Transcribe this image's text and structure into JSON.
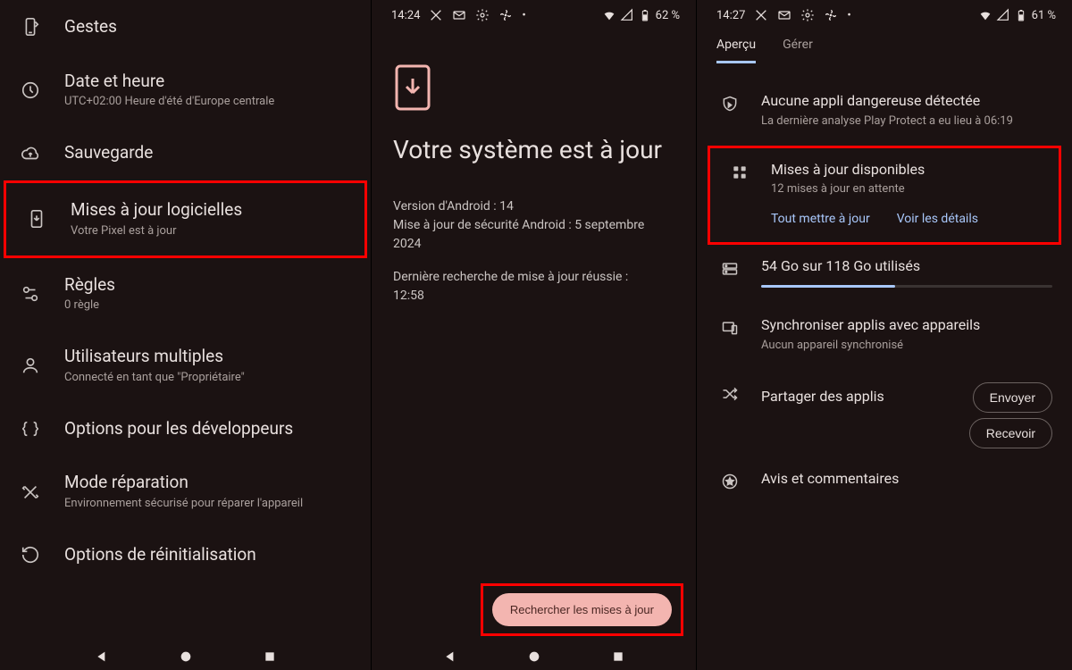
{
  "screen1": {
    "rows": [
      {
        "title": "Gestes",
        "sub": ""
      },
      {
        "title": "Date et heure",
        "sub": "UTC+02:00 Heure d'été d'Europe centrale"
      },
      {
        "title": "Sauvegarde",
        "sub": ""
      },
      {
        "title": "Mises à jour logicielles",
        "sub": "Votre Pixel est à jour"
      },
      {
        "title": "Règles",
        "sub": "0 règle"
      },
      {
        "title": "Utilisateurs multiples",
        "sub": "Connecté en tant que \"Propriétaire\""
      },
      {
        "title": "Options pour les développeurs",
        "sub": ""
      },
      {
        "title": "Mode réparation",
        "sub": "Environnement sécurisé pour réparer l'appareil"
      },
      {
        "title": "Options de réinitialisation",
        "sub": ""
      }
    ]
  },
  "screen2": {
    "status": {
      "time": "14:24",
      "battery": "62 %"
    },
    "heading": "Votre système est à jour",
    "line1": "Version d'Android : 14",
    "line2": "Mise à jour de sécurité Android : 5 septembre 2024",
    "line3a": "Dernière recherche de mise à jour réussie :",
    "line3b": "12:58",
    "button": "Rechercher les mises à jour"
  },
  "screen3": {
    "status": {
      "time": "14:27",
      "battery": "61 %"
    },
    "tabs": {
      "overview": "Aperçu",
      "manage": "Gérer"
    },
    "protect": {
      "title": "Aucune appli dangereuse détectée",
      "sub": "La dernière analyse Play Protect a eu lieu à 06:19"
    },
    "updates": {
      "title": "Mises à jour disponibles",
      "sub": "12 mises à jour en attente",
      "action1": "Tout mettre à jour",
      "action2": "Voir les détails"
    },
    "storage": {
      "title": "54 Go sur 118 Go utilisés"
    },
    "sync": {
      "title": "Synchroniser applis avec appareils",
      "sub": "Aucun appareil synchronisé"
    },
    "share": {
      "title": "Partager des applis",
      "send": "Envoyer",
      "receive": "Recevoir"
    },
    "reviews": {
      "title": "Avis et commentaires"
    }
  }
}
